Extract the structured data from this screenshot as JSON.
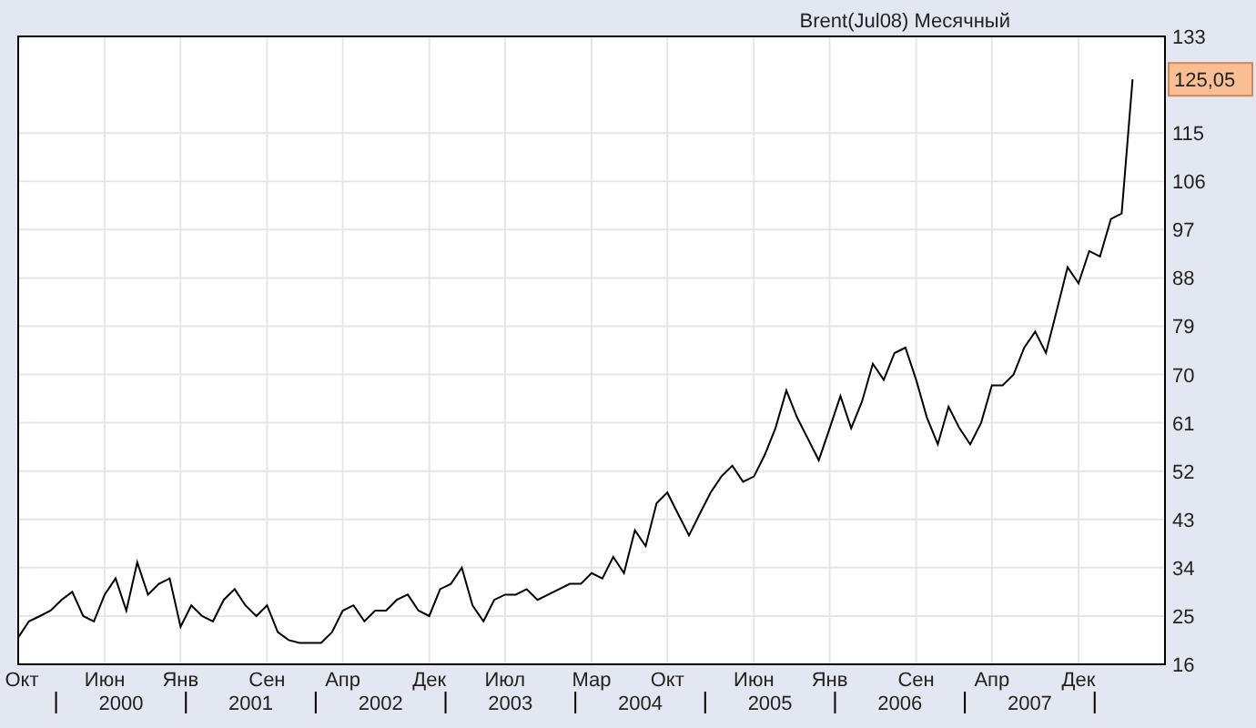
{
  "chart": {
    "price_tag": "125,05",
    "year_labels": [
      "2000",
      "2001",
      "2002",
      "2003",
      "2004",
      "2005",
      "2006",
      "2007"
    ],
    "chart_data": {
      "type": "line",
      "title": "Brent(Jul08) Месячный",
      "categories": [
        "Окт",
        null,
        null,
        null,
        null,
        null,
        null,
        null,
        "Июн",
        null,
        null,
        null,
        null,
        null,
        null,
        "Янв",
        null,
        null,
        null,
        null,
        null,
        null,
        null,
        "Сен",
        null,
        null,
        null,
        null,
        null,
        null,
        "Апр",
        null,
        null,
        null,
        null,
        null,
        null,
        null,
        "Дек",
        null,
        null,
        null,
        null,
        null,
        null,
        "Июл",
        null,
        null,
        null,
        null,
        null,
        null,
        null,
        "Мар",
        null,
        null,
        null,
        null,
        null,
        null,
        "Окт",
        null,
        null,
        null,
        null,
        null,
        null,
        null,
        "Июн",
        null,
        null,
        null,
        null,
        null,
        null,
        "Янв",
        null,
        null,
        null,
        null,
        null,
        null,
        null,
        "Сен",
        null,
        null,
        null,
        null,
        null,
        null,
        "Апр",
        null,
        null,
        null,
        null,
        null,
        null,
        null,
        "Дек",
        null,
        null,
        null,
        null,
        null
      ],
      "grid": true,
      "series": [
        {
          "color": "#000000",
          "values": [
            21,
            24,
            25,
            26,
            28,
            29.5,
            25,
            24,
            29,
            32,
            26,
            35,
            29,
            31,
            32,
            23,
            27,
            25,
            24,
            28,
            30,
            27,
            25,
            27,
            22,
            20.5,
            20,
            20,
            20,
            22,
            26,
            27,
            24,
            26,
            26,
            28,
            29,
            26,
            25,
            30,
            31,
            34,
            27,
            24,
            28,
            29,
            29,
            30,
            28,
            29,
            30,
            31,
            31,
            33,
            32,
            36,
            33,
            41,
            38,
            46,
            48,
            44,
            40,
            44,
            48,
            51,
            53,
            50,
            51,
            55,
            60,
            67,
            62,
            58,
            54,
            60,
            66,
            60,
            65,
            72,
            69,
            74,
            75,
            69,
            62,
            57,
            64,
            60,
            57,
            61,
            68,
            68,
            70,
            75,
            78,
            74,
            82,
            90,
            87,
            93,
            92,
            99,
            100,
            125
          ]
        }
      ],
      "ylim": [
        16,
        133
      ],
      "yticks": [
        16,
        25,
        34,
        43,
        52,
        61,
        70,
        79,
        88,
        97,
        106,
        115,
        133
      ]
    }
  }
}
